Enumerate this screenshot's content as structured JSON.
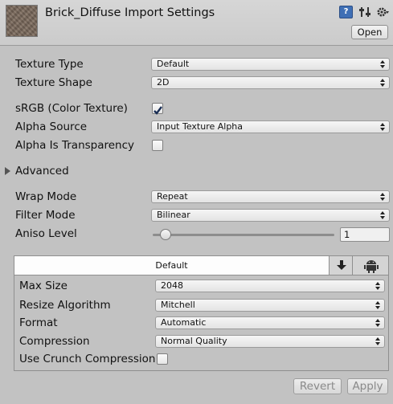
{
  "header": {
    "title": "Brick_Diffuse Import Settings",
    "help_icon": "help-icon",
    "preset_icon": "preset-sliders-icon",
    "settings_icon": "gear-icon",
    "open_label": "Open"
  },
  "fields": {
    "texture_type": {
      "label": "Texture Type",
      "value": "Default"
    },
    "texture_shape": {
      "label": "Texture Shape",
      "value": "2D"
    },
    "srgb": {
      "label": "sRGB (Color Texture)",
      "checked": true
    },
    "alpha_source": {
      "label": "Alpha Source",
      "value": "Input Texture Alpha"
    },
    "alpha_transparency": {
      "label": "Alpha Is Transparency",
      "checked": false
    },
    "advanced": {
      "label": "Advanced",
      "expanded": false
    },
    "wrap_mode": {
      "label": "Wrap Mode",
      "value": "Repeat"
    },
    "filter_mode": {
      "label": "Filter Mode",
      "value": "Bilinear"
    },
    "aniso_level": {
      "label": "Aniso Level",
      "value": "1",
      "slider_fraction": 0.06
    }
  },
  "platform": {
    "tabs": [
      {
        "label": "Default",
        "selected": true
      },
      {
        "icon": "download-icon"
      },
      {
        "icon": "android-icon"
      }
    ],
    "max_size": {
      "label": "Max Size",
      "value": "2048"
    },
    "resize_algorithm": {
      "label": "Resize Algorithm",
      "value": "Mitchell"
    },
    "format": {
      "label": "Format",
      "value": "Automatic"
    },
    "compression": {
      "label": "Compression",
      "value": "Normal Quality"
    },
    "crunch": {
      "label": "Use Crunch Compression",
      "checked": false
    }
  },
  "footer": {
    "revert_label": "Revert",
    "apply_label": "Apply"
  },
  "colors": {
    "background": "#c2c2c2",
    "checkmark": "#1a2e55",
    "help_icon": "#3f6fb5"
  }
}
